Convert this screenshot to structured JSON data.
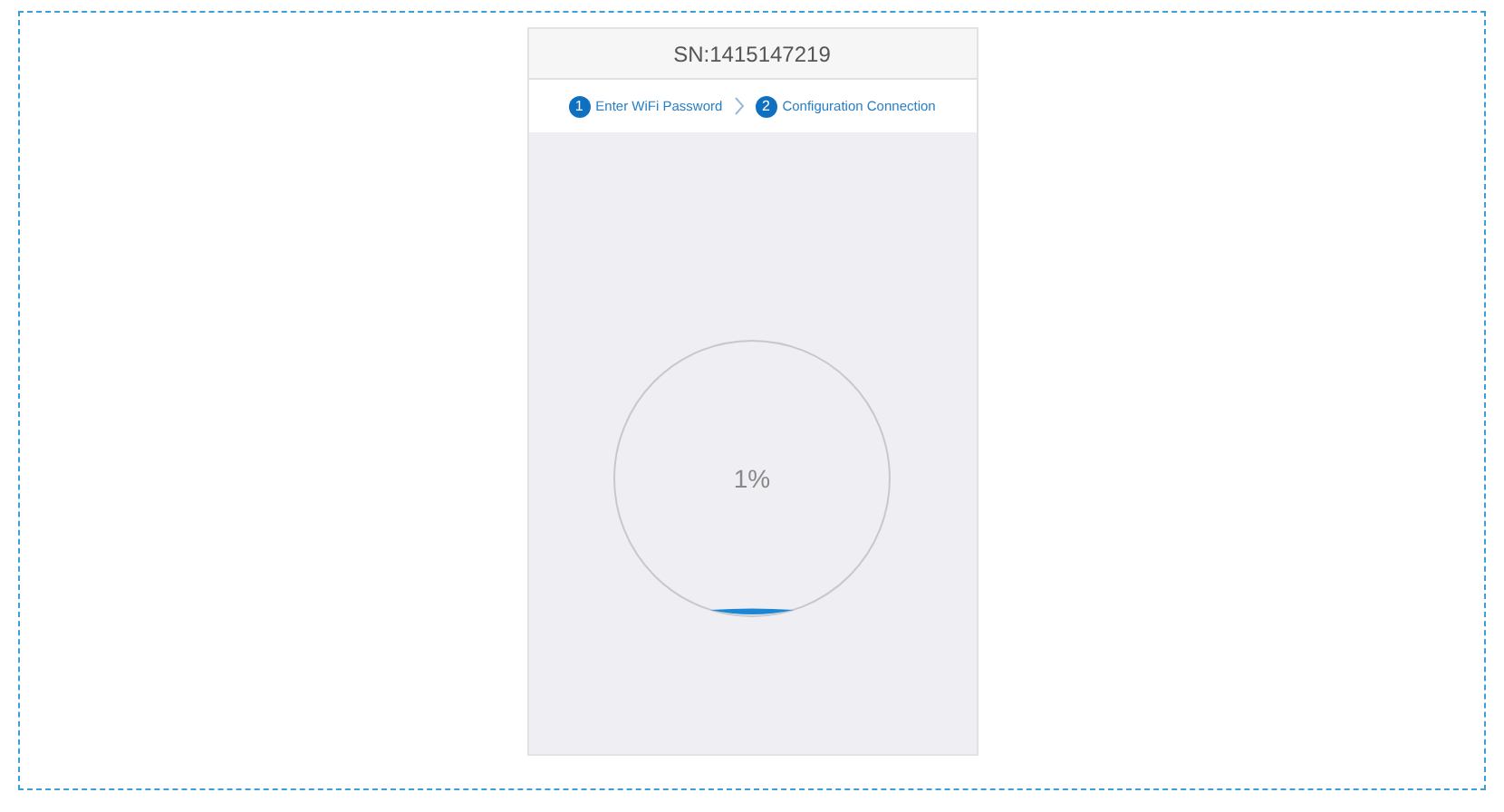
{
  "header": {
    "title": "SN:1415147219"
  },
  "steps": [
    {
      "number": "1",
      "label": "Enter WiFi Password"
    },
    {
      "number": "2",
      "label": "Configuration Connection"
    }
  ],
  "progress": {
    "reading": "1%"
  }
}
